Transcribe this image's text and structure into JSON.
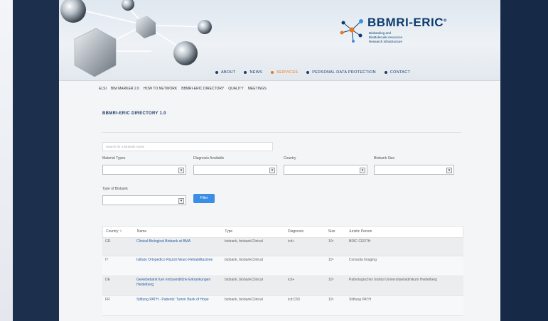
{
  "logo": {
    "title": "BBMRI-ERIC",
    "registered": "®",
    "subtitle": [
      "Biobanking and",
      "BioMolecular resources",
      "Research Infrastructure"
    ]
  },
  "main_nav": [
    {
      "label": "ABOUT",
      "active": false
    },
    {
      "label": "NEWS",
      "active": false
    },
    {
      "label": "SERVICES",
      "active": true
    },
    {
      "label": "PERSONAL DATA PROTECTION",
      "active": false
    },
    {
      "label": "CONTACT",
      "active": false
    }
  ],
  "sub_nav": [
    "ELSI",
    "BIM MARKER 2.0",
    "HOW TO NETWORK",
    "BBMRI-ERIC DIRECTORY",
    "QUALITY",
    "MEETINGS"
  ],
  "page_title": "BBMRI-ERIC DIRECTORY 1.0",
  "search": {
    "placeholder": "Search for a biobank name"
  },
  "filters": {
    "material_types": "Material Types",
    "diagnosis_available": "Diagnosis Available",
    "country": "Country",
    "biobank_size": "Biobank Size",
    "type_of_biobank": "Type of Biobank",
    "button": "Filter"
  },
  "table": {
    "columns": [
      "Country",
      "Name",
      "Type",
      "Diagnosis",
      "Size",
      "Juristic Person"
    ],
    "rows": [
      {
        "country": "GR",
        "name": "Clinical Biological Biobank at BMA",
        "type": "biobank, biobankClinical",
        "diagnosis": "icd+",
        "size": "10⁵",
        "juristic": "BRIC CERTH"
      },
      {
        "country": "IT",
        "name": "Istituto Ortopedico Rizzoli Neuro Rehabilitazione",
        "type": "biobank, biobankClinical",
        "diagnosis": "",
        "size": "10⁵",
        "juristic": "Consulta Imaging"
      },
      {
        "country": "DE",
        "name": "Gewebebank fuer entzuendliche Erkrankungen Heidelberg",
        "type": "biobank, biobankClinical",
        "diagnosis": "icd+",
        "size": "10⁵",
        "juristic": "Pathologisches Institut Universitaetsklinikum Heidelberg"
      },
      {
        "country": "FR",
        "name": "Stiftung PATH - Patients' Tumor Bank of Hope",
        "type": "biobank, biobankClinical",
        "diagnosis": "icd:C50",
        "size": "10⁵",
        "juristic": "Stiftung PATH"
      }
    ]
  },
  "colors": {
    "accent": "#e87722",
    "nav": "#1e3c6a",
    "link": "#2a5da6",
    "button": "#3a8ee6",
    "background": "#1c2f4c"
  }
}
